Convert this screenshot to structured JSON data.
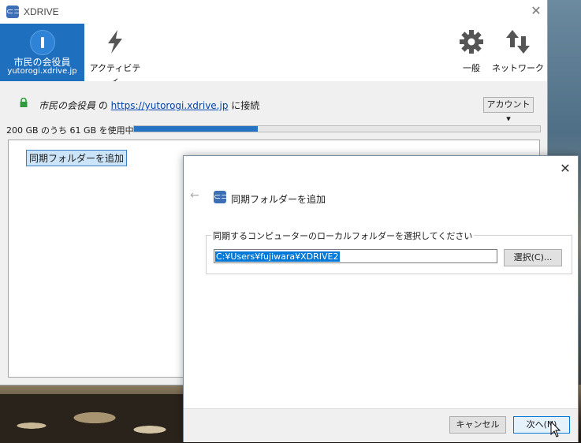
{
  "app": {
    "title": "XDRIVE",
    "logo_glyph": "⊂⊃"
  },
  "toolbar": {
    "account_name": "市民の会役員",
    "account_domain": "yutorogi.xdrive.jp",
    "activity_label": "アクティビティ",
    "general_label": "一般",
    "network_label": "ネットワーク"
  },
  "info": {
    "account_italic": "市民の会役員",
    "of": " の ",
    "url": "https://yutorogi.xdrive.jp",
    "connected": " に接続",
    "account_button": "アカウント ▾"
  },
  "usage": {
    "text": "200 GB のうち 61 GB を使用中",
    "used_gb": 61,
    "total_gb": 200,
    "used_fraction": 0.305
  },
  "folders": {
    "add_link": "同期フォルダーを追加"
  },
  "dialog": {
    "back": "←",
    "title": "同期フォルダーを追加",
    "group_label": "同期するコンピューターのローカルフォルダーを選択してください",
    "path_value": "C:¥Users¥fujiwara¥XDRIVE2",
    "browse_button": "選択(C)...",
    "cancel_button": "キャンセル",
    "next_button": "次へ(N)",
    "close": "✕"
  },
  "window": {
    "close": "✕"
  },
  "colors": {
    "accent": "#1f6fbf",
    "progress": "#2673c4",
    "lock": "#2e9c3a"
  }
}
